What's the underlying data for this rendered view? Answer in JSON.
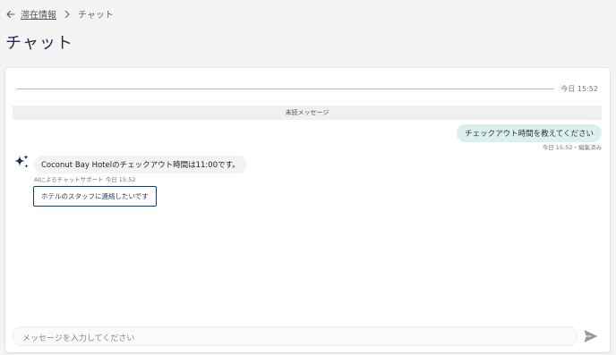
{
  "breadcrumb": {
    "back_icon": "arrow-left-icon",
    "parent": "滞在情報",
    "separator_icon": "chevron-right-icon",
    "current": "チャット"
  },
  "page": {
    "title": "チャット"
  },
  "chat": {
    "date_divider": "今日 15:52",
    "unread_label": "未読メッセージ",
    "messages": [
      {
        "sender": "user",
        "text": "チェックアウト時間を教えてください",
        "meta": "今日 15:52・編集済み"
      },
      {
        "sender": "bot",
        "icon": "sparkle-icon",
        "text": "Coconut Bay Hotelのチェックアウト時間は11:00です。",
        "meta": "AIによるチャットサポート 今日 15:52",
        "action_label": "ホテルのスタッフに連絡したいです"
      }
    ]
  },
  "composer": {
    "placeholder": "メッセージを入力してください",
    "send_icon": "send-icon"
  },
  "colors": {
    "background": "#f4f4f4",
    "title": "#1f2d4d",
    "user_bubble": "#dbefef",
    "bot_bubble": "#f3f3f3",
    "accent": "#1f3a5f"
  }
}
